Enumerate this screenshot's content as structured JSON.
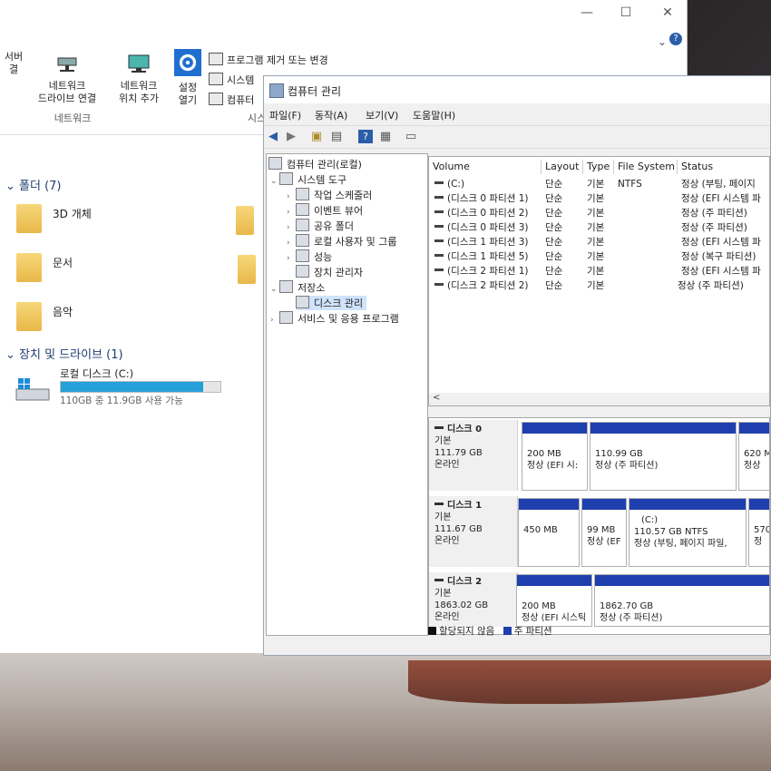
{
  "explorer": {
    "ribbon": {
      "server_label": "서버",
      "server_label2": "결",
      "network_drive_label": "네트워크",
      "network_drive_label2": "드라이브 연결",
      "network_loc_label": "네트워크",
      "network_loc_label2": "위치 추가",
      "settings_label": "설정",
      "settings_label2": "열기",
      "uninstall_label": "프로그램 제거 또는 변경",
      "system_label": "시스템",
      "computer_label": "컴퓨터",
      "group_network": "네트워크",
      "group_system": "시스"
    },
    "folders_header": "폴더 (7)",
    "folders": [
      "3D 개체",
      "문서",
      "음악"
    ],
    "devices_header": "장치 및 드라이브 (1)",
    "drive": {
      "name": "로컬 디스크 (C:)",
      "usage_text": "110GB 중 11.9GB 사용 가능",
      "used_fraction": 0.89
    },
    "help_icon_label": "?"
  },
  "cm": {
    "title": "컴퓨터 관리",
    "menu": [
      "파일(F)",
      "동작(A)",
      "보기(V)",
      "도움말(H)"
    ],
    "tree": {
      "root": "컴퓨터 관리(로컬)",
      "system_tools": "시스템 도구",
      "task_scheduler": "작업 스케줄러",
      "event_viewer": "이벤트 뷰어",
      "shared_folders": "공유 폴더",
      "local_users": "로컬 사용자 및 그룹",
      "performance": "성능",
      "device_manager": "장치 관리자",
      "storage": "저장소",
      "disk_management": "디스크 관리",
      "services": "서비스 및 응용 프로그램"
    },
    "table": {
      "headers": [
        "Volume",
        "Layout",
        "Type",
        "File System",
        "Status"
      ],
      "rows": [
        {
          "volume": "(C:)",
          "layout": "단순",
          "type": "기본",
          "fs": "NTFS",
          "status": "정상 (부팅, 페이지"
        },
        {
          "volume": "(디스크 0 파티션 1)",
          "layout": "단순",
          "type": "기본",
          "fs": "",
          "status": "정상 (EFI 시스템 파"
        },
        {
          "volume": "(디스크 0 파티션 2)",
          "layout": "단순",
          "type": "기본",
          "fs": "",
          "status": "정상 (주 파티션)"
        },
        {
          "volume": "(디스크 0 파티션 3)",
          "layout": "단순",
          "type": "기본",
          "fs": "",
          "status": "정상 (주 파티션)"
        },
        {
          "volume": "(디스크 1 파티션 3)",
          "layout": "단순",
          "type": "기본",
          "fs": "",
          "status": "정상 (EFI 시스템 파"
        },
        {
          "volume": "(디스크 1 파티션 5)",
          "layout": "단순",
          "type": "기본",
          "fs": "",
          "status": "정상 (복구 파티션)"
        },
        {
          "volume": "(디스크 2 파티션 1)",
          "layout": "단순",
          "type": "기본",
          "fs": "",
          "status": "정상 (EFI 시스템 파"
        },
        {
          "volume": "(디스크 2 파티션 2)",
          "layout": "단순",
          "type": "기본",
          "fs": "",
          "status": "정상 (주 파티션)"
        }
      ],
      "scroll_left": "<"
    },
    "disks": [
      {
        "name": "디스크 0",
        "kind": "기본",
        "size": "111.79 GB",
        "state": "온라인",
        "parts": [
          {
            "line1": "",
            "line2": "200 MB",
            "line3": "정상 (EFI 시:"
          },
          {
            "line1": "",
            "line2": "110.99 GB",
            "line3": "정상 (주 파티션)"
          },
          {
            "line1": "",
            "line2": "620 M",
            "line3": "정상"
          }
        ]
      },
      {
        "name": "디스크 1",
        "kind": "기본",
        "size": "111.67 GB",
        "state": "온라인",
        "parts": [
          {
            "line1": "",
            "line2": "450 MB",
            "line3": ""
          },
          {
            "line1": "",
            "line2": "99 MB",
            "line3": "정상 (EF"
          },
          {
            "line1": "(C:)",
            "line2": "110.57 GB NTFS",
            "line3": "정상 (부팅, 페이지 파일,"
          },
          {
            "line1": "",
            "line2": "570",
            "line3": "정"
          }
        ]
      },
      {
        "name": "디스크 2",
        "kind": "기본",
        "size": "1863.02 GB",
        "state": "온라인",
        "parts": [
          {
            "line1": "",
            "line2": "200 MB",
            "line3": "정상 (EFI 시스틱"
          },
          {
            "line1": "",
            "line2": "1862.70 GB",
            "line3": "정상 (주 파티션)"
          }
        ]
      }
    ],
    "legend": {
      "unallocated": "할당되지 않음",
      "primary": "주 파티션"
    }
  },
  "colors": {
    "partition_bar": "#1f3fae",
    "drive_bar": "#26a0da",
    "selection": "#cfe3fb"
  }
}
